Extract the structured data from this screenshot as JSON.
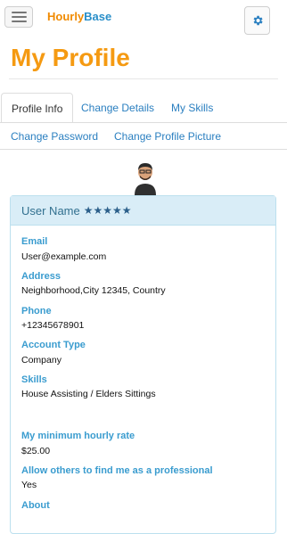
{
  "brand": {
    "part1": "Hourly",
    "part2": "Base"
  },
  "page": {
    "title": "My Profile"
  },
  "tabs": [
    {
      "label": "Profile Info",
      "active": true
    },
    {
      "label": "Change Details"
    },
    {
      "label": "My Skills"
    },
    {
      "label": "Change Password"
    },
    {
      "label": "Change Profile Picture"
    }
  ],
  "profile": {
    "username": "User Name",
    "rating": "★★★★★",
    "fields": [
      {
        "label": "Email",
        "value": "User@example.com"
      },
      {
        "label": "Address",
        "value": "Neighborhood,City 12345, Country"
      },
      {
        "label": "Phone",
        "value": "+12345678901"
      },
      {
        "label": "Account Type",
        "value": "Company"
      },
      {
        "label": "Skills",
        "value": "House Assisting / Elders Sittings"
      },
      {
        "label": "My minimum hourly rate",
        "value": "$25.00"
      },
      {
        "label": "Allow others to find me as a professional",
        "value": "Yes"
      },
      {
        "label": "About",
        "value": ""
      }
    ]
  },
  "colors": {
    "accent_orange": "#f59a12",
    "link_blue": "#2a7fc0",
    "label_blue": "#3a9ccf",
    "panel_head": "#d9edf7"
  },
  "icons": {
    "menu": "hamburger-icon",
    "settings": "gear-icon"
  }
}
